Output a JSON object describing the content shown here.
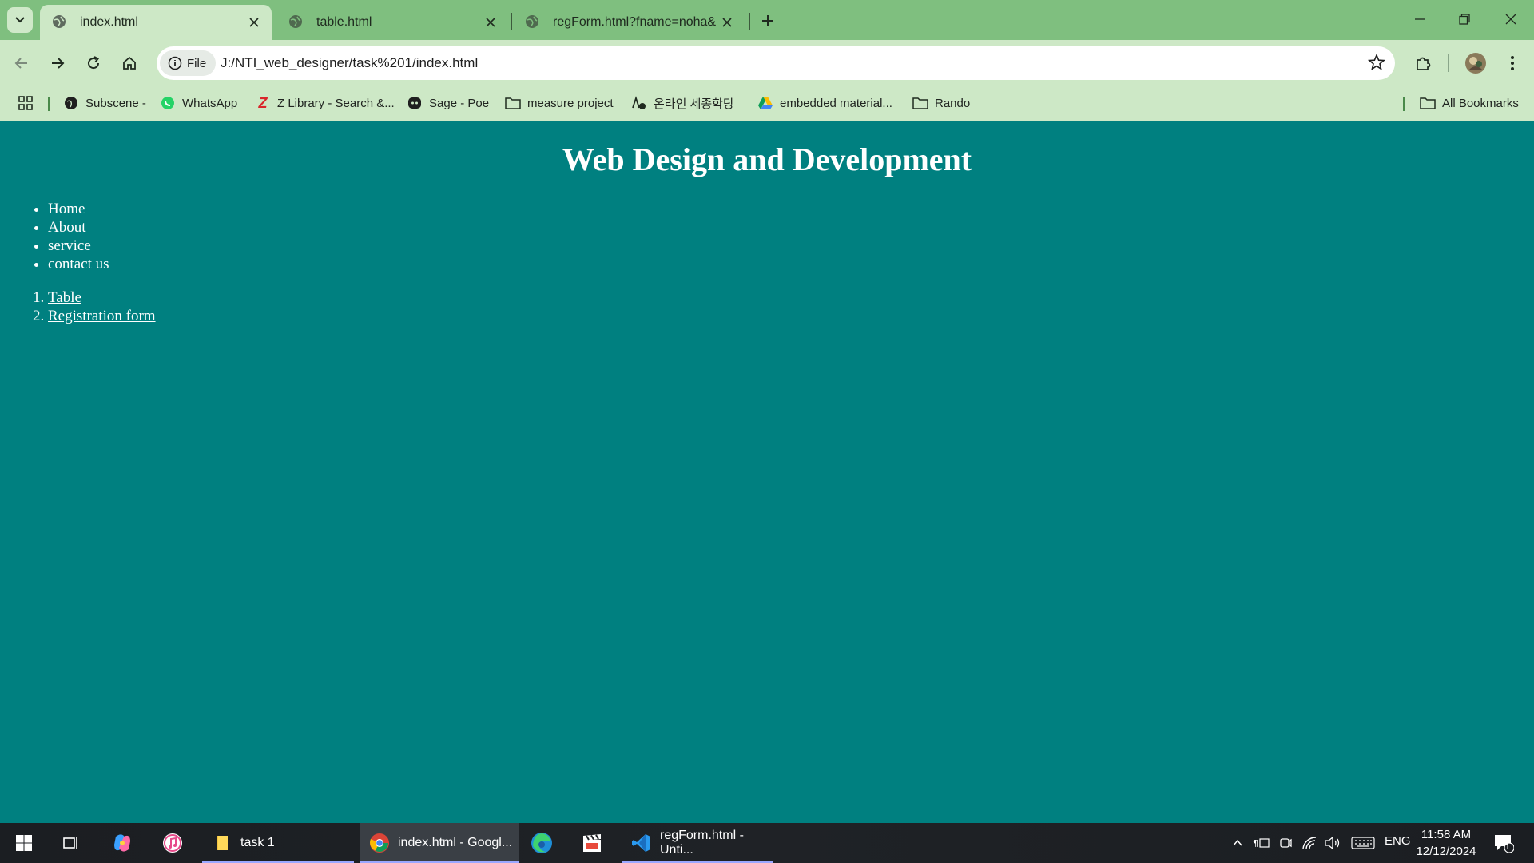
{
  "browser": {
    "tabs": [
      {
        "label": "index.html",
        "active": true
      },
      {
        "label": "table.html",
        "active": false
      },
      {
        "label": "regForm.html?fname=noha&ln",
        "active": false
      }
    ],
    "address": {
      "chip": "File",
      "url": "J:/NTI_web_designer/task%201/index.html"
    },
    "bookmarks": [
      {
        "label": "Subscene -",
        "icon": "globe-icon"
      },
      {
        "label": "WhatsApp",
        "icon": "whatsapp-icon"
      },
      {
        "label": "Z Library - Search &...",
        "icon": "zlibrary-icon"
      },
      {
        "label": "Sage - Poe",
        "icon": "poe-icon"
      },
      {
        "label": "measure project",
        "icon": "folder-icon"
      },
      {
        "label": "온라인 세종학당",
        "icon": "sejong-icon"
      },
      {
        "label": "embedded material...",
        "icon": "drive-icon"
      },
      {
        "label": "Rando",
        "icon": "folder-icon"
      }
    ],
    "all_bookmarks": "All Bookmarks"
  },
  "page": {
    "heading": "Web Design and Development",
    "nav_items": [
      "Home",
      "About",
      "service",
      "contact us"
    ],
    "links": [
      "Table",
      "Registration form"
    ]
  },
  "taskbar": {
    "apps": [
      {
        "label": "task 1",
        "icon": "file-explorer-icon"
      },
      {
        "label": "index.html - Googl...",
        "icon": "chrome-icon"
      },
      {
        "label": "regForm.html - Unti...",
        "icon": "vscode-icon"
      }
    ],
    "language": "ENG",
    "time": "11:58 AM",
    "date": "12/12/2024",
    "notification_count": "1"
  },
  "colors": {
    "page_bg": "#008080",
    "chrome_bg": "#cde8c6",
    "tabstrip_bg": "#7fbf7f"
  }
}
